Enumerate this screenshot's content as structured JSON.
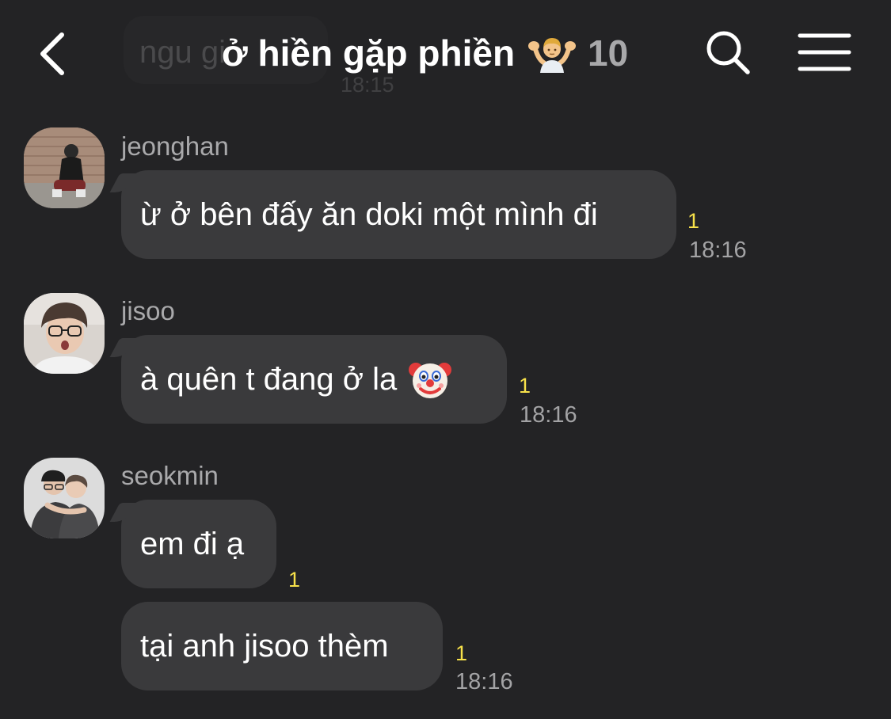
{
  "header": {
    "ghost_message": "ngu gi",
    "ghost_time": "18:15",
    "title": "ở hiền gặp phiền",
    "member_count": "10"
  },
  "colors": {
    "background": "#232325",
    "bubble": "#3a3a3c",
    "unread": "#f7e14a",
    "muted_text": "#a9a9ab"
  },
  "messages": [
    {
      "sender": "jeonghan",
      "text": "ừ ở bên đấy ăn doki một mình đi",
      "unread": "1",
      "time": "18:16"
    },
    {
      "sender": "jisoo",
      "text": "à quên t đang ở la",
      "emoji": "clown-face",
      "unread": "1",
      "time": "18:16"
    },
    {
      "sender": "seokmin",
      "text": "em đi ạ",
      "unread": "1",
      "time": ""
    },
    {
      "sender": "",
      "text": "tại anh jisoo thèm",
      "unread": "1",
      "time": "18:16"
    }
  ],
  "icons": {
    "back": "chevron-left-icon",
    "search": "search-icon",
    "menu": "hamburger-menu-icon",
    "title_emoji": "person-shrugging-emoji"
  }
}
